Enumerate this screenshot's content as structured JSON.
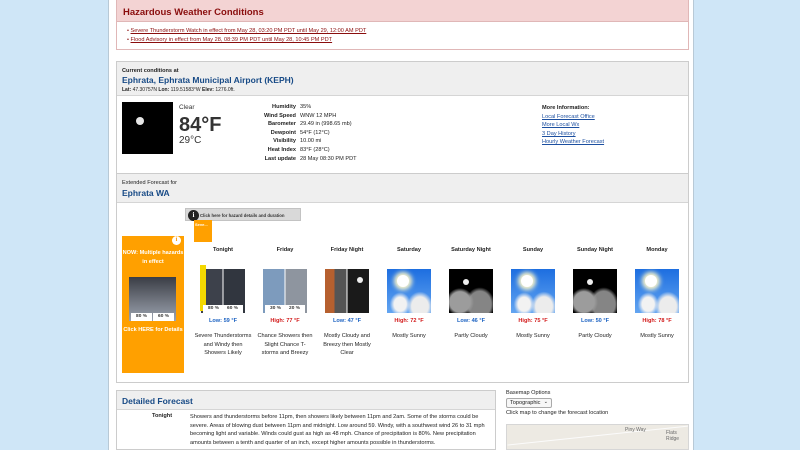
{
  "hazards": {
    "title": "Hazardous Weather Conditions",
    "items": [
      "Severe Thunderstorm Watch in effect from May 28, 03:20 PM PDT until May 29, 12:00 AM PDT",
      "Flood Advisory in effect from May 28, 08:39 PM PDT until May 28, 10:45 PM PDT"
    ]
  },
  "current": {
    "pretitle": "Current conditions at",
    "title": "Ephrata, Ephrata Municipal Airport (KEPH)",
    "lat_label": "Lat:",
    "lat": "47.30757N",
    "lon_label": "Lon:",
    "lon": "119.51583°W",
    "elev_label": "Elev:",
    "elev": "1276.0ft.",
    "condition": "Clear",
    "temp_f": "84°F",
    "temp_c": "29°C",
    "details": [
      {
        "k": "Humidity",
        "v": "35%"
      },
      {
        "k": "Wind Speed",
        "v": "WNW 12 MPH"
      },
      {
        "k": "Barometer",
        "v": "29.49 in (998.65 mb)"
      },
      {
        "k": "Dewpoint",
        "v": "54°F (12°C)"
      },
      {
        "k": "Visibility",
        "v": "10.00 mi"
      },
      {
        "k": "Heat Index",
        "v": "83°F (28°C)"
      },
      {
        "k": "Last update",
        "v": "28 May 08:30 PM PDT"
      }
    ],
    "more_title": "More Information:",
    "more_links": [
      "Local Forecast Office",
      "More Local Wx",
      "3 Day History",
      "Hourly Weather Forecast"
    ]
  },
  "extended": {
    "pretitle": "Extended Forecast for",
    "title": "Ephrata WA",
    "hazard_click": "Click here for hazard details and duration",
    "hazard_box": {
      "text": "NOW: Multiple hazards in effect",
      "link": "Click HERE for Details",
      "pop_left": "80 %",
      "pop_right": "60 %"
    },
    "severe_tag": "Seve...",
    "periods": [
      {
        "name": "Tonight",
        "temp": "Low: 59 °F",
        "kind": "lo",
        "icon": "thunderstorm-icon",
        "desc": "Severe Thunderstorms and Windy then Showers Likely",
        "pop_left": "80 %",
        "pop_right": "60 %"
      },
      {
        "name": "Friday",
        "temp": "High: 77 °F",
        "kind": "hi",
        "icon": "showers-icon",
        "desc": "Chance Showers then Slight Chance T-storms and Breezy",
        "pop_left": "30 %",
        "pop_right": "20 %"
      },
      {
        "name": "Friday Night",
        "temp": "Low: 47 °F",
        "kind": "lo",
        "icon": "mostly-cloudy-night-icon",
        "desc": "Mostly Cloudy and Breezy then Mostly Clear",
        "pop_left": "",
        "pop_right": ""
      },
      {
        "name": "Saturday",
        "temp": "High: 72 °F",
        "kind": "hi",
        "icon": "sunny-icon",
        "desc": "Mostly Sunny",
        "pop_left": "",
        "pop_right": ""
      },
      {
        "name": "Saturday Night",
        "temp": "Low: 46 °F",
        "kind": "lo",
        "icon": "partly-cloudy-night-icon",
        "desc": "Partly Cloudy",
        "pop_left": "",
        "pop_right": ""
      },
      {
        "name": "Sunday",
        "temp": "High: 75 °F",
        "kind": "hi",
        "icon": "sunny-icon",
        "desc": "Mostly Sunny",
        "pop_left": "",
        "pop_right": ""
      },
      {
        "name": "Sunday Night",
        "temp": "Low: 50 °F",
        "kind": "lo",
        "icon": "partly-cloudy-night-icon",
        "desc": "Partly Cloudy",
        "pop_left": "",
        "pop_right": ""
      },
      {
        "name": "Monday",
        "temp": "High: 78 °F",
        "kind": "hi",
        "icon": "sunny-icon",
        "desc": "Mostly Sunny",
        "pop_left": "",
        "pop_right": ""
      }
    ]
  },
  "detailed": {
    "title": "Detailed Forecast",
    "day": "Tonight",
    "text": "Showers and thunderstorms before 11pm, then showers likely between 11pm and 2am. Some of the storms could be severe. Areas of blowing dust between 11pm and midnight. Low around 59. Windy, with a southwest wind 26 to 31 mph becoming light and variable. Winds could gust as high as 48 mph. Chance of precipitation is 80%. New precipitation amounts between a tenth and quarter of an inch, except higher amounts possible in thunderstorms."
  },
  "map": {
    "options_label": "Basemap Options",
    "selected": "Topographic",
    "hint": "Click map to change the forecast location",
    "labels": [
      "Piny Way",
      "Flats Ridge"
    ]
  }
}
